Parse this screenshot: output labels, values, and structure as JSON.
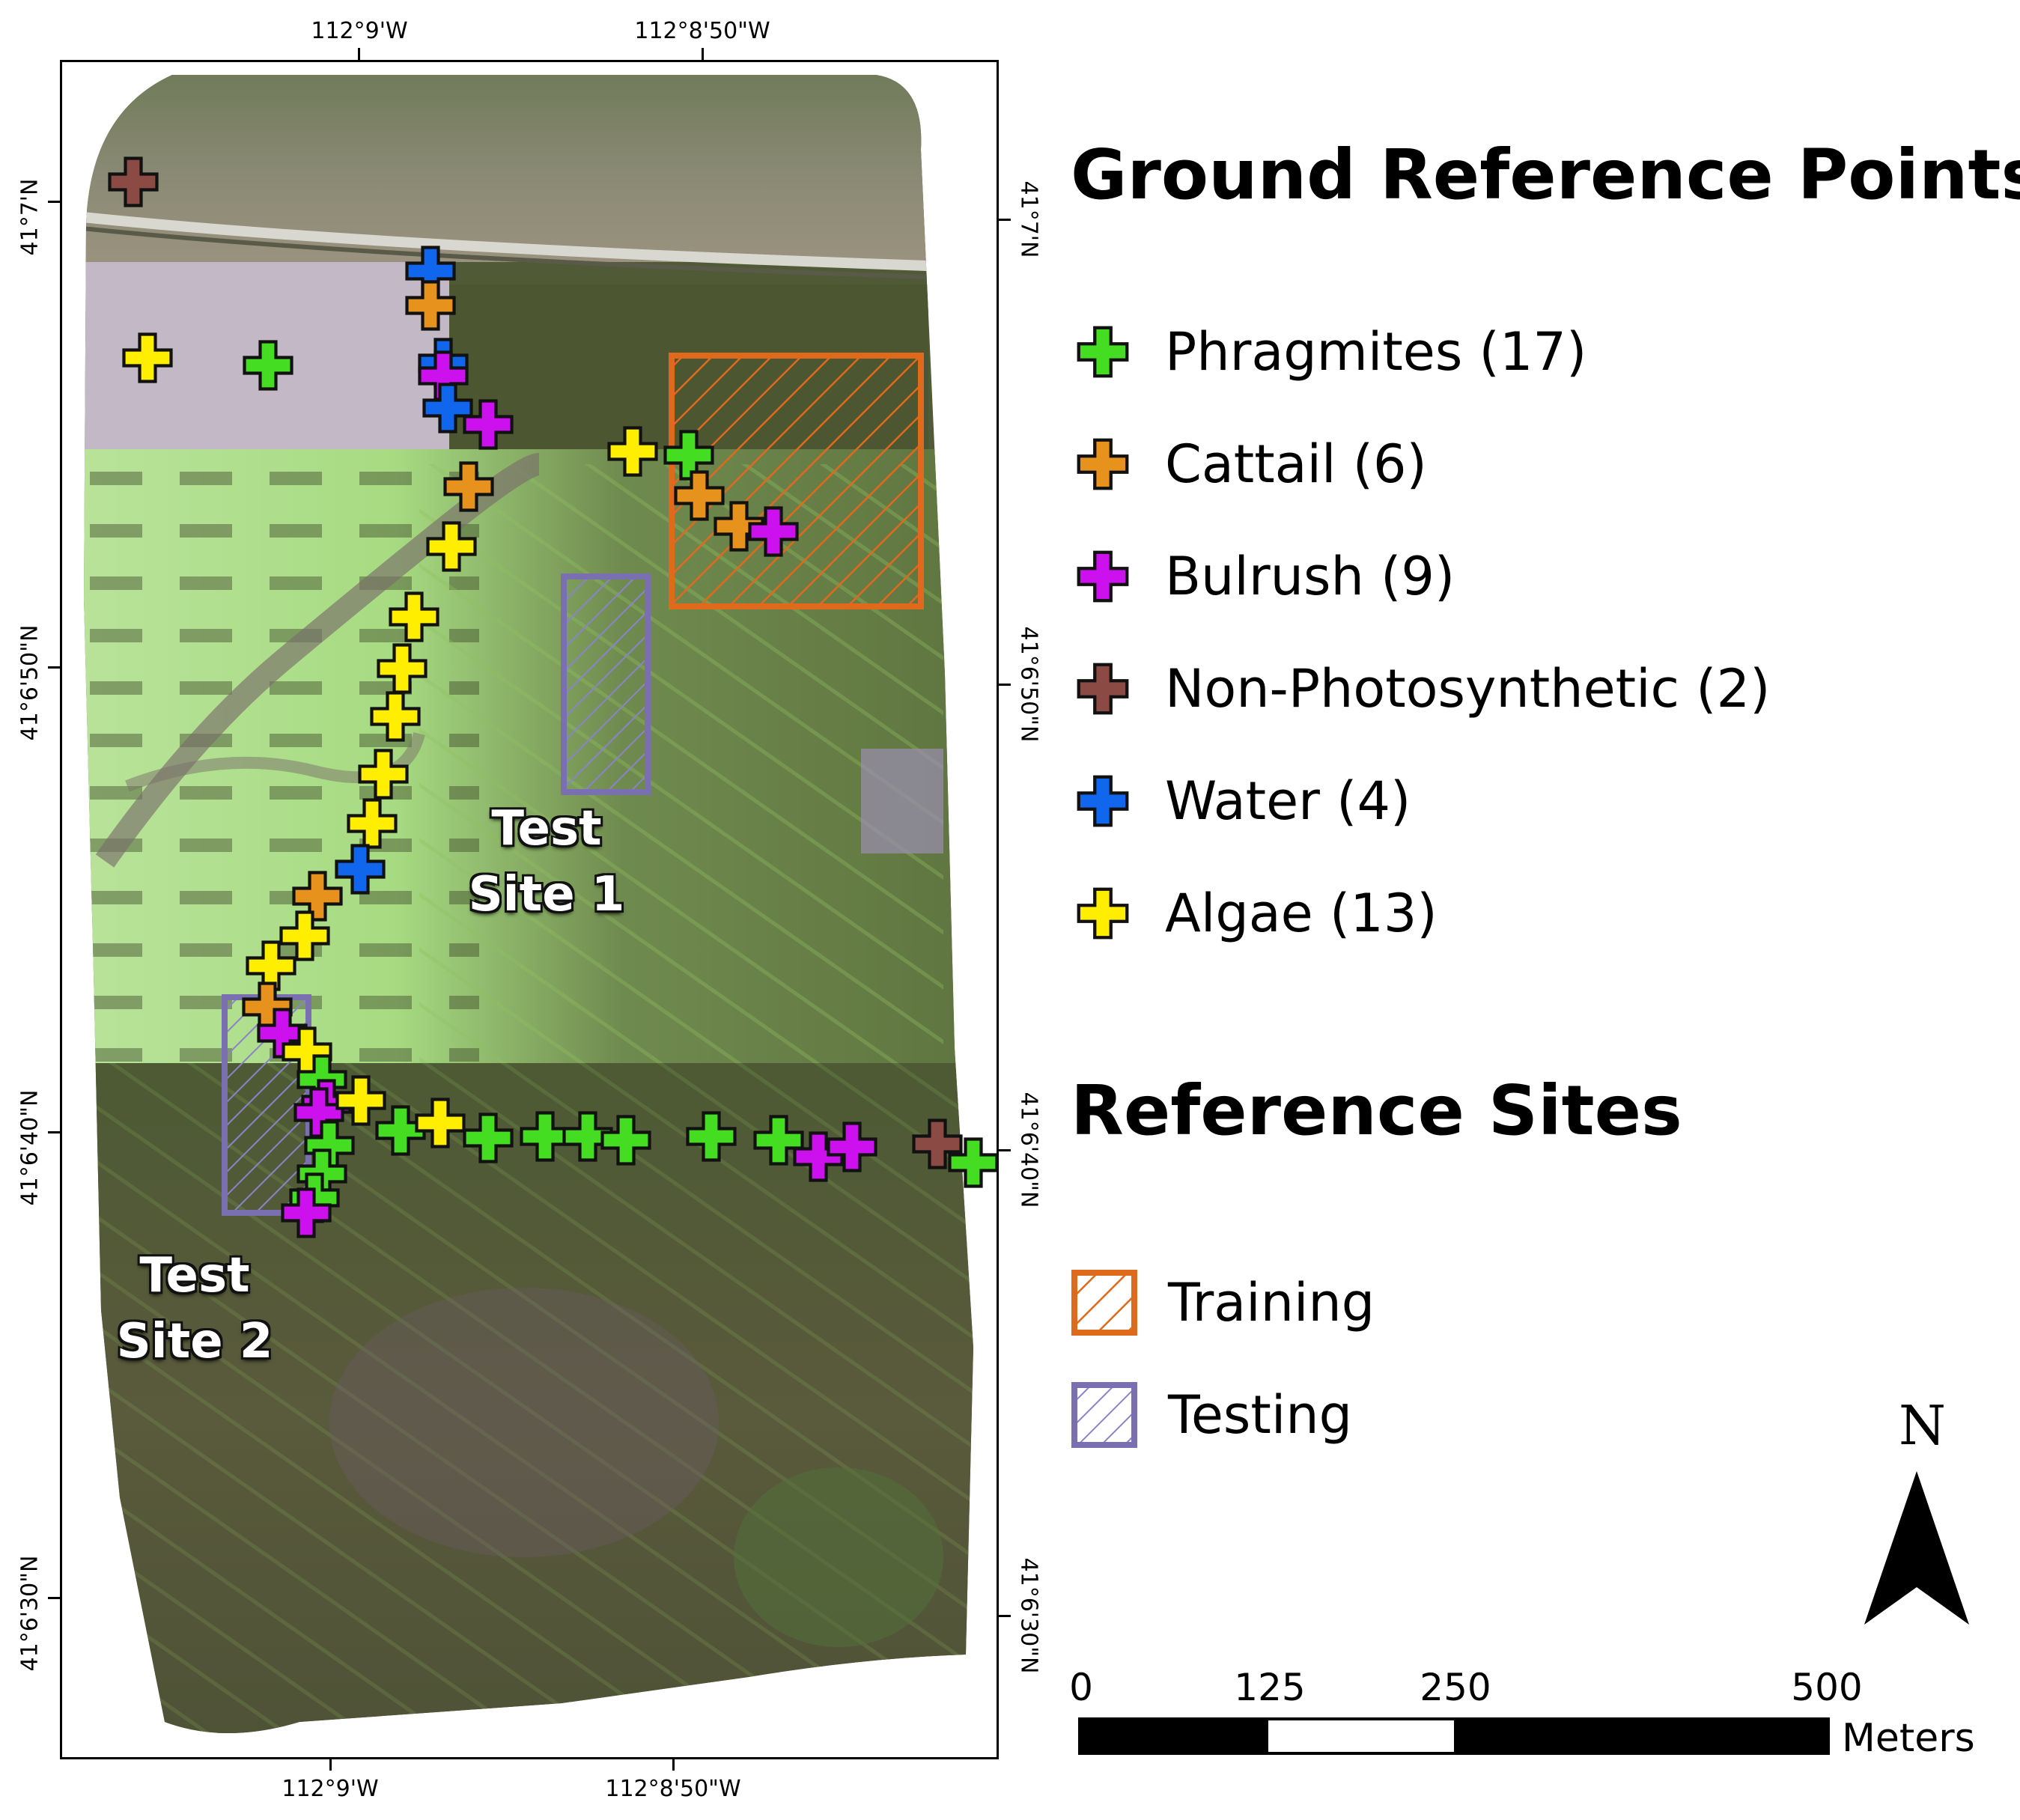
{
  "map": {
    "top_labels": [
      "112°9'W",
      "112°8'50\"W"
    ],
    "bottom_labels": [
      "112°9'W",
      "112°8'50\"W"
    ],
    "left_labels": [
      "41°7'N",
      "41°6'50\"N",
      "41°6'40\"N",
      "41°6'30\"N"
    ],
    "right_labels": [
      "41°7'N",
      "41°6'50\"N",
      "41°6'40\"N",
      "41°6'30\"N"
    ],
    "site_labels": [
      {
        "line1": "Test",
        "line2": "Site 1"
      },
      {
        "line1": "Test",
        "line2": "Site 2"
      }
    ]
  },
  "legend": {
    "points_title": "Ground Reference Points",
    "points": [
      {
        "label": "Phragmites (17)",
        "color": "#44dd22"
      },
      {
        "label": "Cattail (6)",
        "color": "#e8921e"
      },
      {
        "label": "Bulrush (9)",
        "color": "#cc11ee"
      },
      {
        "label": "Non-Photosynthetic (2)",
        "color": "#8b4a44"
      },
      {
        "label": "Water (4)",
        "color": "#1166ee"
      },
      {
        "label": "Algae (13)",
        "color": "#ffee00"
      }
    ],
    "sites_title": "Reference Sites",
    "sites": [
      {
        "label": "Training",
        "color": "#e06a1c"
      },
      {
        "label": "Testing",
        "color": "#7a6fb0"
      }
    ]
  },
  "scale_bar": {
    "ticks": [
      "0",
      "125",
      "250",
      "500"
    ],
    "unit": "Meters"
  },
  "north_arrow": {
    "letter": "N"
  }
}
